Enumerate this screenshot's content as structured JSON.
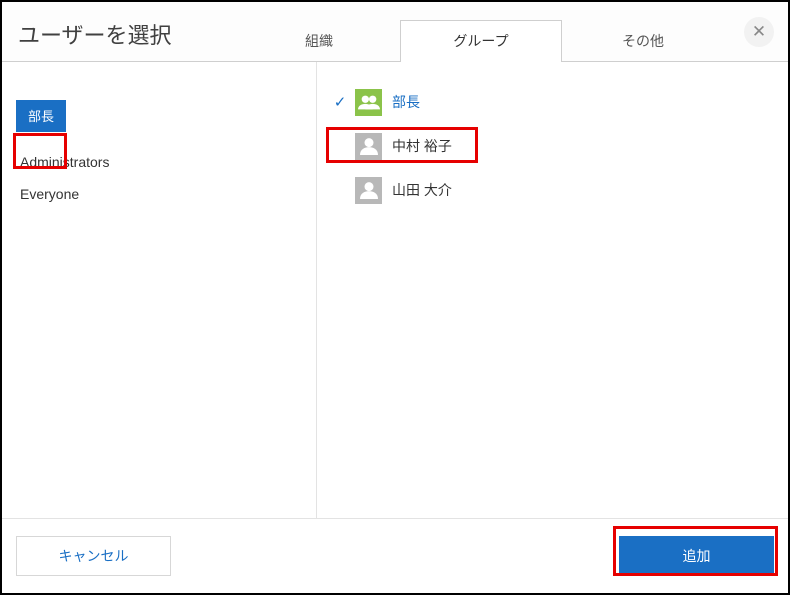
{
  "dialog": {
    "title": "ユーザーを選択"
  },
  "tabs": [
    {
      "label": "組織",
      "active": false
    },
    {
      "label": "グループ",
      "active": true
    },
    {
      "label": "その他",
      "active": false
    }
  ],
  "sidebar": {
    "selected_chip": "部長",
    "items": [
      {
        "label": "Administrators"
      },
      {
        "label": "Everyone"
      }
    ]
  },
  "list": {
    "rows": [
      {
        "label": "部長",
        "type": "group",
        "selected": true
      },
      {
        "label": "中村 裕子",
        "type": "user",
        "selected": false
      },
      {
        "label": "山田 大介",
        "type": "user",
        "selected": false
      }
    ]
  },
  "footer": {
    "cancel": "キャンセル",
    "add": "追加"
  },
  "icons": {
    "close": "✕",
    "check": "✓"
  },
  "colors": {
    "primary": "#1a6fc4",
    "highlight": "#e60000",
    "group_avatar": "#8bc34a"
  }
}
